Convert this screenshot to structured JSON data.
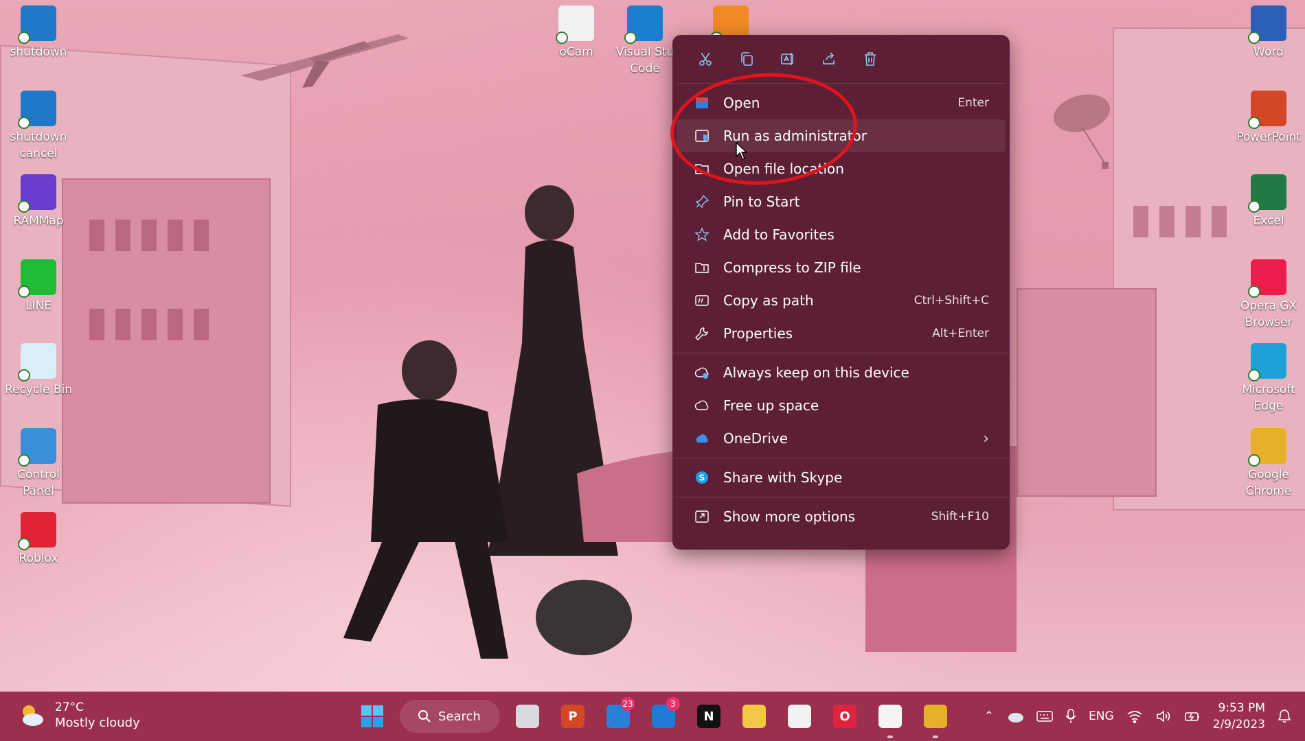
{
  "desktop_left": [
    {
      "name": "shutdown",
      "label": "shutdown",
      "icon": "shutdown-icon",
      "color": "#1f78c8"
    },
    {
      "name": "shutdown-cancel",
      "label": "shutdown\ncancel",
      "icon": "shutdown-cancel-icon",
      "color": "#1f78c8"
    },
    {
      "name": "rammap",
      "label": "RAMMap",
      "icon": "rammap-icon",
      "color": "#6a3dd1"
    },
    {
      "name": "line",
      "label": "LINE",
      "icon": "line-icon",
      "color": "#1fbd37"
    },
    {
      "name": "recycle-bin",
      "label": "Recycle Bin",
      "icon": "recycle-bin-icon",
      "color": "#d9eef9"
    },
    {
      "name": "control-panel",
      "label": "Control Panel",
      "icon": "control-panel-icon",
      "color": "#3b8fd8"
    },
    {
      "name": "roblox",
      "label": "Roblox",
      "icon": "roblox-icon",
      "color": "#e02435"
    }
  ],
  "desktop_top": [
    {
      "name": "ocam",
      "label": "oCam",
      "icon": "ocam-icon",
      "color": "#f1f1f1"
    },
    {
      "name": "visual-studio-code",
      "label": "Visual Stu\nCode",
      "icon": "vscode-icon",
      "color": "#1a7ed1"
    },
    {
      "name": "xampp",
      "label": "",
      "icon": "xampp-icon",
      "color": "#f08a24"
    }
  ],
  "desktop_right": [
    {
      "name": "word",
      "label": "Word",
      "icon": "word-icon",
      "color": "#2b5fb8"
    },
    {
      "name": "powerpoint",
      "label": "PowerPoint",
      "icon": "powerpoint-icon",
      "color": "#d24726"
    },
    {
      "name": "excel",
      "label": "Excel",
      "icon": "excel-icon",
      "color": "#1f7a45"
    },
    {
      "name": "opera-gx",
      "label": "Opera GX\nBrowser",
      "icon": "opera-gx-icon",
      "color": "#ea1d4c"
    },
    {
      "name": "microsoft-edge",
      "label": "Microsoft\nEdge",
      "icon": "edge-icon",
      "color": "#1da1d6"
    },
    {
      "name": "google-chrome",
      "label": "Google\nChrome",
      "icon": "chrome-icon",
      "color": "#e7b02a"
    }
  ],
  "context_menu": {
    "toolbar": [
      "cut-icon",
      "copy-icon",
      "rename-icon",
      "share-icon",
      "delete-icon"
    ],
    "groups": [
      [
        {
          "label": "Open",
          "shortcut": "Enter",
          "icon": "open-icon"
        },
        {
          "label": "Run as administrator",
          "shortcut": "",
          "icon": "run-as-admin-icon"
        },
        {
          "label": "Open file location",
          "shortcut": "",
          "icon": "folder-icon"
        },
        {
          "label": "Pin to Start",
          "shortcut": "",
          "icon": "pin-icon"
        },
        {
          "label": "Add to Favorites",
          "shortcut": "",
          "icon": "star-icon"
        },
        {
          "label": "Compress to ZIP file",
          "shortcut": "",
          "icon": "zip-icon"
        },
        {
          "label": "Copy as path",
          "shortcut": "Ctrl+Shift+C",
          "icon": "copy-path-icon"
        },
        {
          "label": "Properties",
          "shortcut": "Alt+Enter",
          "icon": "wrench-icon"
        }
      ],
      [
        {
          "label": "Always keep on this device",
          "shortcut": "",
          "icon": "cloud-sync-icon"
        },
        {
          "label": "Free up space",
          "shortcut": "",
          "icon": "cloud-icon"
        },
        {
          "label": "OneDrive",
          "shortcut": "",
          "icon": "onedrive-icon",
          "submenu": true
        }
      ],
      [
        {
          "label": "Share with Skype",
          "shortcut": "",
          "icon": "skype-icon"
        }
      ],
      [
        {
          "label": "Show more options",
          "shortcut": "Shift+F10",
          "icon": "more-options-icon"
        }
      ]
    ]
  },
  "taskbar": {
    "weather": {
      "temp": "27°C",
      "condition": "Mostly cloudy"
    },
    "search_label": "Search",
    "apps": [
      {
        "name": "task-view",
        "icon": "task-view-icon",
        "badge": ""
      },
      {
        "name": "powerpoint",
        "icon": "powerpoint-icon",
        "badge": ""
      },
      {
        "name": "microsoft-teams",
        "icon": "teams-icon",
        "badge": "23"
      },
      {
        "name": "mail",
        "icon": "mail-icon",
        "badge": "3"
      },
      {
        "name": "netflix",
        "icon": "netflix-icon",
        "badge": ""
      },
      {
        "name": "file-explorer",
        "icon": "file-explorer-icon",
        "badge": ""
      },
      {
        "name": "microsoft-store",
        "icon": "store-icon",
        "badge": ""
      },
      {
        "name": "opera",
        "icon": "opera-icon",
        "badge": ""
      },
      {
        "name": "ocam",
        "icon": "ocam-icon",
        "badge": ""
      },
      {
        "name": "google-chrome",
        "icon": "chrome-icon",
        "badge": ""
      }
    ],
    "language": "ENG",
    "time": "9:53 PM",
    "date": "2/9/2023"
  },
  "colors": {
    "menu_bg": "#5d1f36",
    "taskbar_bg": "#9b2f4d",
    "annotation": "#e0141c"
  }
}
